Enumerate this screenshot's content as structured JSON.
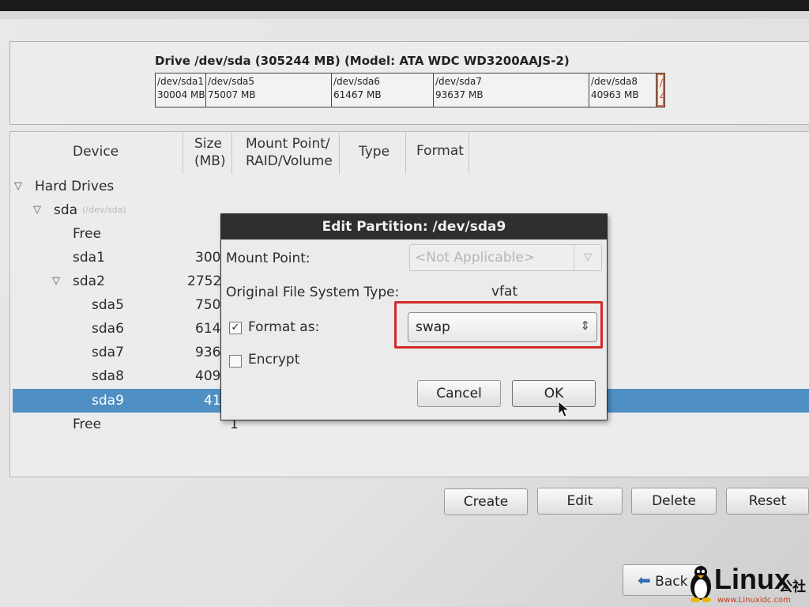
{
  "drive": {
    "title": "Drive /dev/sda (305244 MB) (Model: ATA WDC WD3200AAJS-2)",
    "segments": [
      {
        "name": "/dev/sda1",
        "size": "30004 MB"
      },
      {
        "name": "/dev/sda5",
        "size": "75007 MB"
      },
      {
        "name": "/dev/sda6",
        "size": "61467 MB"
      },
      {
        "name": "/dev/sda7",
        "size": "93637 MB"
      },
      {
        "name": "/dev/sda8",
        "size": "40963 MB"
      },
      {
        "name": "/",
        "size": "4"
      }
    ]
  },
  "table": {
    "headers": {
      "device": "Device",
      "size_line1": "Size",
      "size_line2": "(MB)",
      "mount_line1": "Mount Point/",
      "mount_line2": "RAID/Volume",
      "type": "Type",
      "format": "Format"
    },
    "rows": [
      {
        "device": "Hard Drives",
        "size": "",
        "hint": ""
      },
      {
        "device": "sda",
        "size": "",
        "hint": "(/dev/sda)"
      },
      {
        "device": "Free",
        "size": "",
        "hint": ""
      },
      {
        "device": "sda1",
        "size": "300",
        "hint": ""
      },
      {
        "device": "sda2",
        "size": "2752",
        "hint": ""
      },
      {
        "device": "sda5",
        "size": "750",
        "hint": ""
      },
      {
        "device": "sda6",
        "size": "614",
        "hint": ""
      },
      {
        "device": "sda7",
        "size": "936",
        "hint": ""
      },
      {
        "device": "sda8",
        "size": "409",
        "hint": ""
      },
      {
        "device": "sda9",
        "size": "41",
        "hint": ""
      },
      {
        "device": "Free",
        "size": "1",
        "hint": ""
      }
    ]
  },
  "buttons": {
    "create": "Create",
    "edit": "Edit",
    "delete": "Delete",
    "reset": "Reset",
    "back": "Back"
  },
  "dialog": {
    "title": "Edit Partition: /dev/sda9",
    "mount_label": "Mount Point:",
    "mount_value": "<Not Applicable>",
    "orig_fs_label": "Original File System Type:",
    "orig_fs_value": "vfat",
    "format_label": "Format as:",
    "format_checked": true,
    "format_value": "swap",
    "encrypt_label": "Encrypt",
    "encrypt_checked": false,
    "cancel": "Cancel",
    "ok": "OK"
  },
  "watermark": {
    "brand": "Linux",
    "suffix": "公社",
    "url": "www.Linuxidc.com"
  },
  "colors": {
    "selection": "#4f8fc4",
    "highlight_box": "#d22a2a",
    "dialog_title_bg": "#2f2f2f"
  }
}
